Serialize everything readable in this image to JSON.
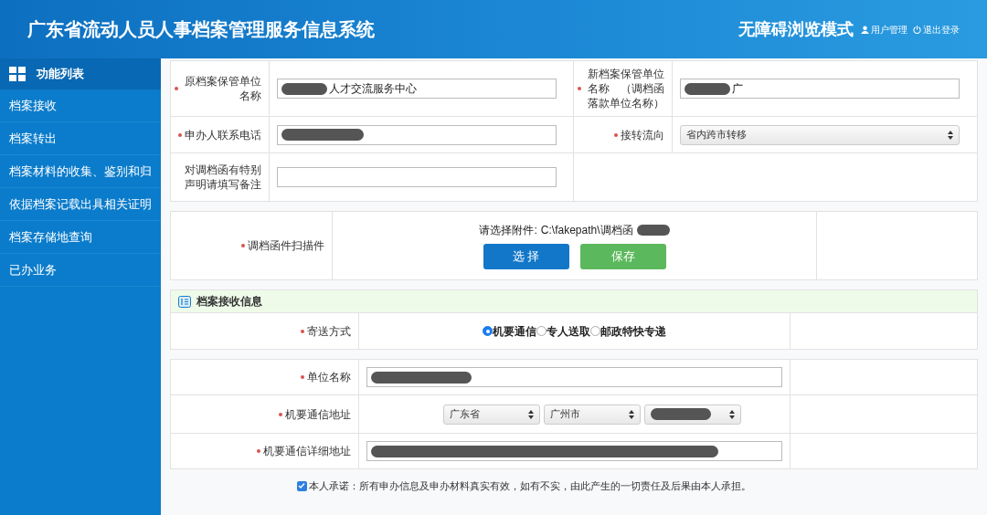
{
  "header": {
    "title": "广东省流动人员人事档案管理服务信息系统",
    "mode": "无障碍浏览模式",
    "links": [
      {
        "kind": "user",
        "label": "用户管理"
      },
      {
        "kind": "power",
        "label": "退出登录"
      }
    ]
  },
  "sidebar": {
    "title": "功能列表",
    "items": [
      {
        "label": "档案接收",
        "selected": false
      },
      {
        "label": "档案转出",
        "selected": false
      },
      {
        "label": "档案材料的收集、鉴别和归",
        "selected": false
      },
      {
        "label": "依据档案记载出具相关证明",
        "selected": false
      },
      {
        "label": "档案存储地查询",
        "selected": false
      },
      {
        "label": "已办业务",
        "selected": false
      }
    ]
  },
  "form": {
    "rows": [
      {
        "cells": [
          {
            "label": "原档案保管单位名称",
            "required": true,
            "kind": "input",
            "value": "人才交流服务中心",
            "redacted": true
          },
          {
            "label": "新档案保管单位名称　（调档函落款单位名称）",
            "required": true,
            "kind": "input",
            "value": "广",
            "redacted": true
          }
        ]
      },
      {
        "cells": [
          {
            "label": "申办人联系电话",
            "required": true,
            "kind": "input",
            "redacted": true
          },
          {
            "label": "接转流向",
            "required": true,
            "kind": "select",
            "value": "省内跨市转移"
          }
        ]
      },
      {
        "cells": [
          {
            "label": "对调档函有特别声明请填写备注",
            "kind": "input"
          }
        ]
      }
    ],
    "attachment": {
      "label": "调档函件扫描件",
      "required": true,
      "prompt": "请选择附件:",
      "path": "C:\\fakepath\\调档函",
      "redacted": true,
      "buttons": [
        {
          "kind": "primary",
          "label": "选 择"
        },
        {
          "kind": "success",
          "label": "保存"
        }
      ]
    }
  },
  "receive": {
    "title": "档案接收信息",
    "delivery": {
      "label": "寄送方式",
      "required": true,
      "options": [
        {
          "label": "机要通信",
          "selected": true
        },
        {
          "label": "专人送取",
          "selected": false
        },
        {
          "label": "邮政特快专递",
          "selected": false
        }
      ]
    },
    "rows": [
      {
        "label": "单位名称",
        "required": true,
        "kind": "input",
        "redacted": true
      },
      {
        "label": "机要通信地址",
        "required": true,
        "kind": "selects",
        "selects": [
          {
            "value": "广东省"
          },
          {
            "value": "广州市"
          },
          {
            "redacted": true
          }
        ]
      },
      {
        "label": "机要通信详细地址",
        "required": true,
        "kind": "input",
        "redacted": true
      }
    ],
    "pledge": {
      "checked": true,
      "text": "本人承诺：所有申办信息及申办材料真实有效，如有不实，由此产生的一切责任及后果由本人承担。"
    }
  }
}
